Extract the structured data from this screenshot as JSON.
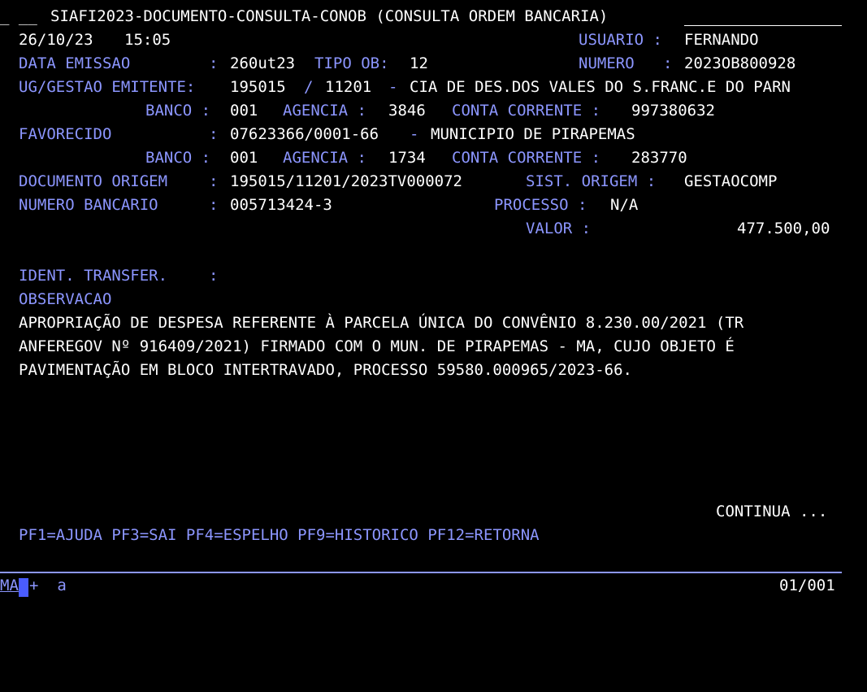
{
  "header": {
    "prefix": "_ __",
    "title": "SIAFI2023-DOCUMENTO-CONSULTA-CONOB (CONSULTA ORDEM BANCARIA)",
    "date": "26/10/23",
    "time": "15:05",
    "usuario_label": "USUARIO :",
    "usuario_value": "FERNANDO"
  },
  "fields": {
    "data_emissao_label": "DATA EMISSAO",
    "data_emissao_value": "260ut23",
    "tipo_ob_label": "TIPO OB:",
    "tipo_ob_value": "12",
    "numero_label": "NUMERO",
    "numero_value": "2023OB800928",
    "ug_gestao_label": "UG/GESTAO EMITENTE:",
    "ug_value": "195015",
    "gestao_value": "11201",
    "ug_nome": "CIA DE DES.DOS VALES DO S.FRANC.E DO PARN",
    "emitente_banco_label": "BANCO :",
    "emitente_banco_value": "001",
    "emitente_agencia_label": "AGENCIA :",
    "emitente_agencia_value": "3846",
    "emitente_conta_label": "CONTA CORRENTE :",
    "emitente_conta_value": "997380632",
    "favorecido_label": "FAVORECIDO",
    "favorecido_cnpj": "07623366/0001-66",
    "favorecido_nome": "MUNICIPIO DE PIRAPEMAS",
    "fav_banco_label": "BANCO :",
    "fav_banco_value": "001",
    "fav_agencia_label": "AGENCIA :",
    "fav_agencia_value": "1734",
    "fav_conta_label": "CONTA CORRENTE :",
    "fav_conta_value": "283770",
    "doc_origem_label": "DOCUMENTO ORIGEM",
    "doc_origem_value": "195015/11201/2023TV000072",
    "sist_origem_label": "SIST. ORIGEM :",
    "sist_origem_value": "GESTAOCOMP",
    "num_bancario_label": "NUMERO BANCARIO",
    "num_bancario_value": "005713424-3",
    "processo_label": "PROCESSO :",
    "processo_value": "N/A",
    "valor_label": "VALOR :",
    "valor_value": "477.500,00",
    "ident_transfer_label": "IDENT. TRANSFER.",
    "colon": ":",
    "slash": "/",
    "dash": "-"
  },
  "observacao": {
    "label": "OBSERVACAO",
    "lines": [
      "APROPRIAÇÃO DE DESPESA REFERENTE À PARCELA ÚNICA DO CONVÊNIO 8.230.00/2021 (TR",
      "ANFEREGOV Nº 916409/2021) FIRMADO COM O MUN. DE PIRAPEMAS - MA, CUJO OBJETO É",
      "PAVIMENTAÇÃO EM BLOCO INTERTRAVADO, PROCESSO 59580.000965/2023-66."
    ]
  },
  "footer": {
    "continua": "CONTINUA ...",
    "pf_keys": "PF1=AJUDA PF3=SAI PF4=ESPELHO PF9=HISTORICO PF12=RETORNA",
    "command_prefix": "MA",
    "command_rest": "+  a",
    "page": "01/001"
  },
  "colors": {
    "background": "#000000",
    "label": "#8c96ff",
    "value": "#ffffff",
    "cursor": "#4a5cff"
  }
}
